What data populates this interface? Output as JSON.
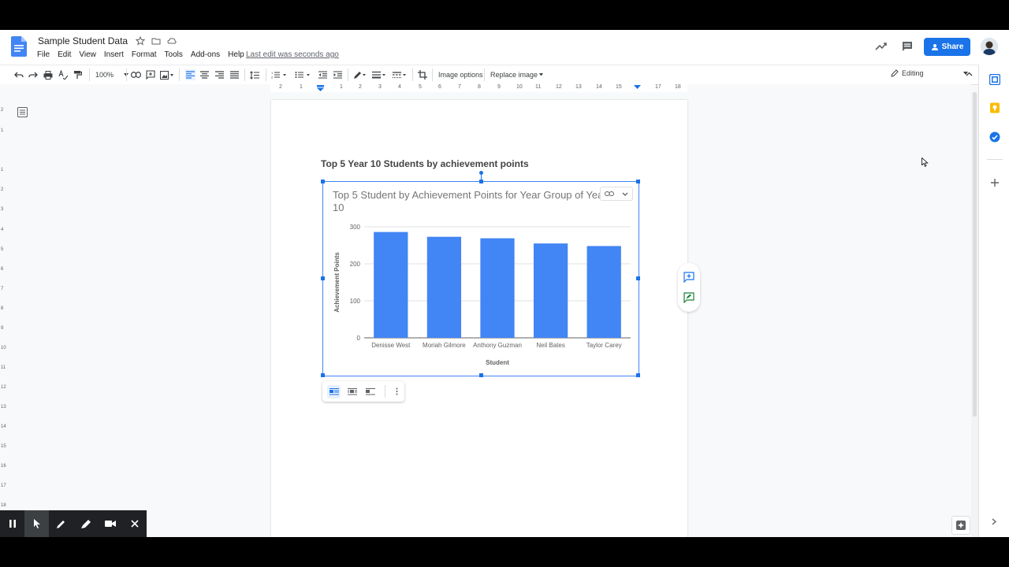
{
  "doc": {
    "title": "Sample Student Data",
    "last_edit": "Last edit was seconds ago"
  },
  "menu": [
    "File",
    "Edit",
    "View",
    "Insert",
    "Format",
    "Tools",
    "Add-ons",
    "Help"
  ],
  "header": {
    "share_label": "Share"
  },
  "toolbar": {
    "zoom": "100%",
    "image_options": "Image options",
    "replace_image": "Replace image",
    "mode": "Editing"
  },
  "ruler": [
    "2",
    "1",
    "1",
    "2",
    "3",
    "4",
    "5",
    "6",
    "7",
    "8",
    "9",
    "10",
    "11",
    "12",
    "13",
    "14",
    "15",
    "16",
    "17",
    "18"
  ],
  "vruler": [
    "2",
    "1",
    "1",
    "2",
    "3",
    "4",
    "5",
    "6",
    "7",
    "8",
    "9",
    "10",
    "11",
    "12",
    "13",
    "14",
    "15",
    "16",
    "17",
    "18"
  ],
  "body": {
    "heading": "Top 5 Year 10 Students by achievement points"
  },
  "chart_data": {
    "type": "bar",
    "title": "Top 5 Student by Achievement Points for Year Group of Year 10",
    "categories": [
      "Denisse West",
      "Moriah Gilmore",
      "Anthony Guzman",
      "Neil Bates",
      "Taylor Carey"
    ],
    "values": [
      286,
      273,
      269,
      255,
      248
    ],
    "xlabel": "Student",
    "ylabel": "Achievement Points",
    "ylim": [
      0,
      300
    ],
    "yticks": [
      "0",
      "100",
      "200",
      "300"
    ],
    "color": "#4285f4",
    "grid": true
  },
  "colors": {
    "accent": "#1a73e8",
    "bar": "#4285f4"
  }
}
